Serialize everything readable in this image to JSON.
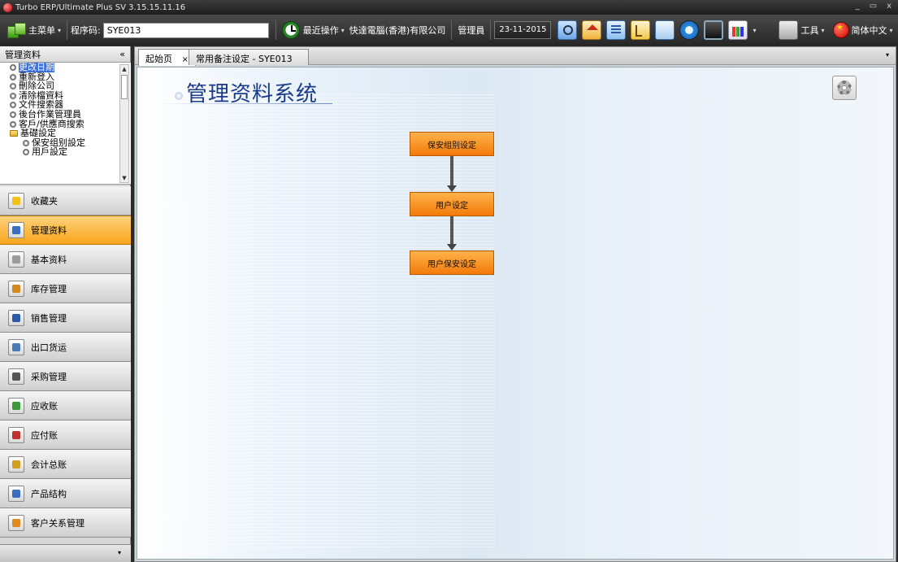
{
  "window": {
    "title": "Turbo ERP/Ultimate Plus SV 3.15.15.11.16",
    "minimize": "_",
    "restore": "▭",
    "close": "x"
  },
  "toolbar": {
    "main_menu": "主菜单",
    "program_code_label": "程序码:",
    "program_code_value": "SYE013",
    "recent_ops": "最近操作",
    "company": "快達電腦(香港)有限公司",
    "user": "管理員",
    "date": "23-11-2015",
    "tools": "工具",
    "language": "简体中文"
  },
  "left_panel": {
    "header": "管理资料",
    "collapse": "«",
    "tree": [
      {
        "label": "更改日期",
        "selected": true,
        "child": false,
        "folder": false
      },
      {
        "label": "重新登入",
        "child": false,
        "folder": false
      },
      {
        "label": "刪除公司",
        "child": false,
        "folder": false
      },
      {
        "label": "清除檔資料",
        "child": false,
        "folder": false
      },
      {
        "label": "文件搜索器",
        "child": false,
        "folder": false
      },
      {
        "label": "後台作業管理員",
        "child": false,
        "folder": false
      },
      {
        "label": "客戶/供應商搜索",
        "child": false,
        "folder": false
      },
      {
        "label": "基礎設定",
        "child": false,
        "folder": true
      },
      {
        "label": "保安组别設定",
        "child": true,
        "folder": false
      },
      {
        "label": "用戶設定",
        "child": true,
        "folder": false
      }
    ],
    "nav": [
      {
        "label": "收藏夹",
        "icon": "star-icon",
        "color": "#f2c21a"
      },
      {
        "label": "管理资料",
        "icon": "admin-user-icon",
        "color": "#3a6ec0",
        "active": true
      },
      {
        "label": "基本资料",
        "icon": "gears-icon",
        "color": "#9a9a9a"
      },
      {
        "label": "库存管理",
        "icon": "boxes-icon",
        "color": "#d08a20"
      },
      {
        "label": "销售管理",
        "icon": "sales-icon",
        "color": "#2a5aa8"
      },
      {
        "label": "出口货运",
        "icon": "export-ship-icon",
        "color": "#4a7ab8"
      },
      {
        "label": "采购管理",
        "icon": "purchase-cart-icon",
        "color": "#555555"
      },
      {
        "label": "应收账",
        "icon": "receivable-icon",
        "color": "#3a9a3a"
      },
      {
        "label": "应付账",
        "icon": "payable-icon",
        "color": "#c03030"
      },
      {
        "label": "会计总账",
        "icon": "ledger-coins-icon",
        "color": "#d0a020"
      },
      {
        "label": "产品结构",
        "icon": "product-structure-icon",
        "color": "#3a6ec0"
      },
      {
        "label": "客户关系管理",
        "icon": "crm-people-icon",
        "color": "#e08a20"
      }
    ],
    "more": "▾"
  },
  "tabs": [
    {
      "label": "起始页",
      "close": "×",
      "active": true
    },
    {
      "label": "常用备注设定 - SYE013",
      "active": false
    }
  ],
  "tabs_menu": "▾",
  "main": {
    "system_title": "管理资料系统",
    "flow": [
      "保安组别设定",
      "用户设定",
      "用户保安设定"
    ]
  }
}
